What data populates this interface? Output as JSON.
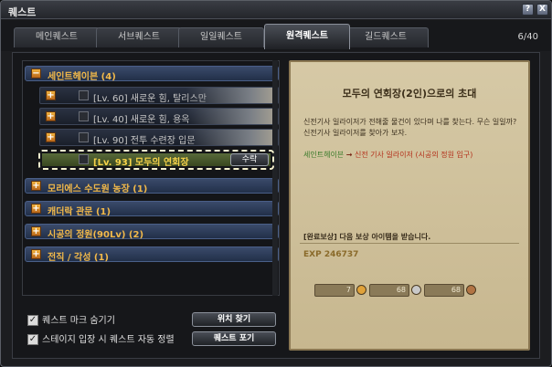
{
  "window": {
    "title": "퀘스트",
    "help_label": "?",
    "close_label": "X"
  },
  "tabs": [
    {
      "label": "메인퀘스트",
      "active": false
    },
    {
      "label": "서브퀘스트",
      "active": false
    },
    {
      "label": "일일퀘스트",
      "active": false
    },
    {
      "label": "원격퀘스트",
      "active": true
    },
    {
      "label": "길드퀘스트",
      "active": false
    }
  ],
  "quest_count": "6/40",
  "categories": [
    {
      "label": "세인트헤이븐 (4)",
      "toggle": "−"
    },
    {
      "label": "모리에스 수도원 농장 (1)",
      "toggle": "+"
    },
    {
      "label": "캐더락 관문 (1)",
      "toggle": "+"
    },
    {
      "label": "시공의 정원(90Lv) (2)",
      "toggle": "+"
    },
    {
      "label": "전직 / 각성 (1)",
      "toggle": "+"
    }
  ],
  "quests": [
    {
      "label": "[Lv. 60] 새로운 힘, 탈리스만",
      "toggle": "+"
    },
    {
      "label": "[Lv. 40] 새로운 힘, 용옥",
      "toggle": "+"
    },
    {
      "label": "[Lv. 90] 전투 수련장 입문",
      "toggle": "+"
    }
  ],
  "selected_quest": {
    "label": "[Lv. 93] 모두의 연회장",
    "accept_label": "수락"
  },
  "options": [
    {
      "label": "퀘스트 마크 숨기기",
      "checked": "✓"
    },
    {
      "label": "스테이지 입장 시 퀘스트 자동 정렬",
      "checked": "✓"
    }
  ],
  "buttons": {
    "find_location": "위치 찾기",
    "abandon": "퀘스트 포기"
  },
  "detail": {
    "title": "모두의 연회장(2인)으로의 초대",
    "description": "신전기사 일라이저가 전해줄 물건이 있다며 나를 찾는다. 무슨 일일까? 신전기사 일라이저를 찾아가 보자.",
    "route_from": "세인트헤이븐",
    "route_arrow": "→",
    "route_to": "신전 기사 일라이저 (시공의 정원 입구)",
    "reward_title": "[완료보상] 다음 보상 아이템을 받습니다.",
    "exp": "EXP 246737",
    "coins": [
      {
        "value": "7",
        "color": "#e0a23a"
      },
      {
        "value": "68",
        "color": "#c9c9c9"
      },
      {
        "value": "68",
        "color": "#b27444"
      }
    ]
  }
}
